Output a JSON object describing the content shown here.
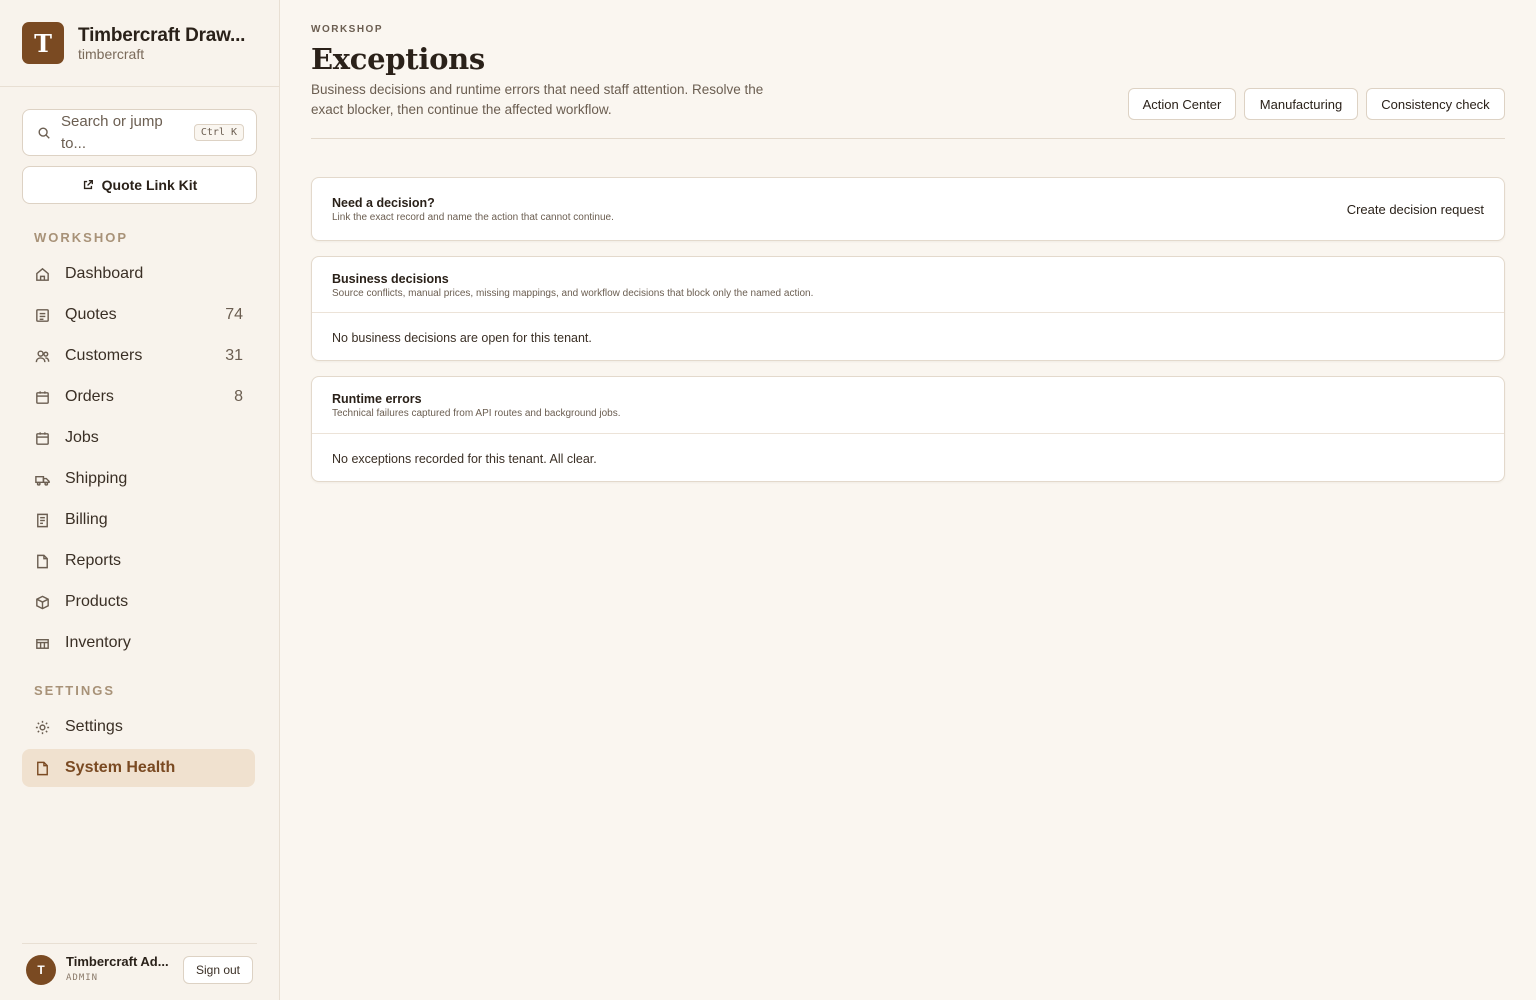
{
  "brand": {
    "initial": "T",
    "title": "Timbercraft Draw...",
    "subtitle": "timbercraft"
  },
  "search": {
    "placeholder": "Search or jump to...",
    "shortcut": "Ctrl K"
  },
  "quote_link": {
    "label": "Quote Link Kit"
  },
  "sidebar": {
    "workshop_label": "WORKSHOP",
    "workshop_items": [
      {
        "label": "Dashboard",
        "count": "",
        "icon": "home-icon"
      },
      {
        "label": "Quotes",
        "count": "74",
        "icon": "document-icon"
      },
      {
        "label": "Customers",
        "count": "31",
        "icon": "users-icon"
      },
      {
        "label": "Orders",
        "count": "8",
        "icon": "calendar-icon"
      },
      {
        "label": "Jobs",
        "count": "",
        "icon": "calendar-icon"
      },
      {
        "label": "Shipping",
        "count": "",
        "icon": "truck-icon"
      },
      {
        "label": "Billing",
        "count": "",
        "icon": "receipt-icon"
      },
      {
        "label": "Reports",
        "count": "",
        "icon": "file-icon"
      },
      {
        "label": "Products",
        "count": "",
        "icon": "box-icon"
      },
      {
        "label": "Inventory",
        "count": "",
        "icon": "warehouse-icon"
      }
    ],
    "settings_label": "SETTINGS",
    "settings_items": [
      {
        "label": "Settings",
        "icon": "gear-icon"
      },
      {
        "label": "System Health",
        "icon": "file-icon"
      }
    ]
  },
  "user": {
    "initial": "T",
    "name": "Timbercraft Ad...",
    "role": "ADMIN",
    "signout": "Sign out"
  },
  "header": {
    "eyebrow": "WORKSHOP",
    "title": "Exceptions",
    "description": "Business decisions and runtime errors that need staff attention. Resolve the exact blocker, then continue the affected workflow.",
    "buttons": [
      "Action Center",
      "Manufacturing",
      "Consistency check"
    ]
  },
  "cards": {
    "decision": {
      "title": "Need a decision?",
      "subtitle": "Link the exact record and name the action that cannot continue.",
      "action": "Create decision request"
    },
    "business": {
      "title": "Business decisions",
      "subtitle": "Source conflicts, manual prices, missing mappings, and workflow decisions that block only the named action.",
      "empty": "No business decisions are open for this tenant."
    },
    "runtime": {
      "title": "Runtime errors",
      "subtitle": "Technical failures captured from API routes and background jobs.",
      "empty": "No exceptions recorded for this tenant. All clear."
    }
  },
  "colors": {
    "accent": "#7a4a22",
    "active_bg": "#f0e1cf",
    "background": "#faf6f0"
  }
}
